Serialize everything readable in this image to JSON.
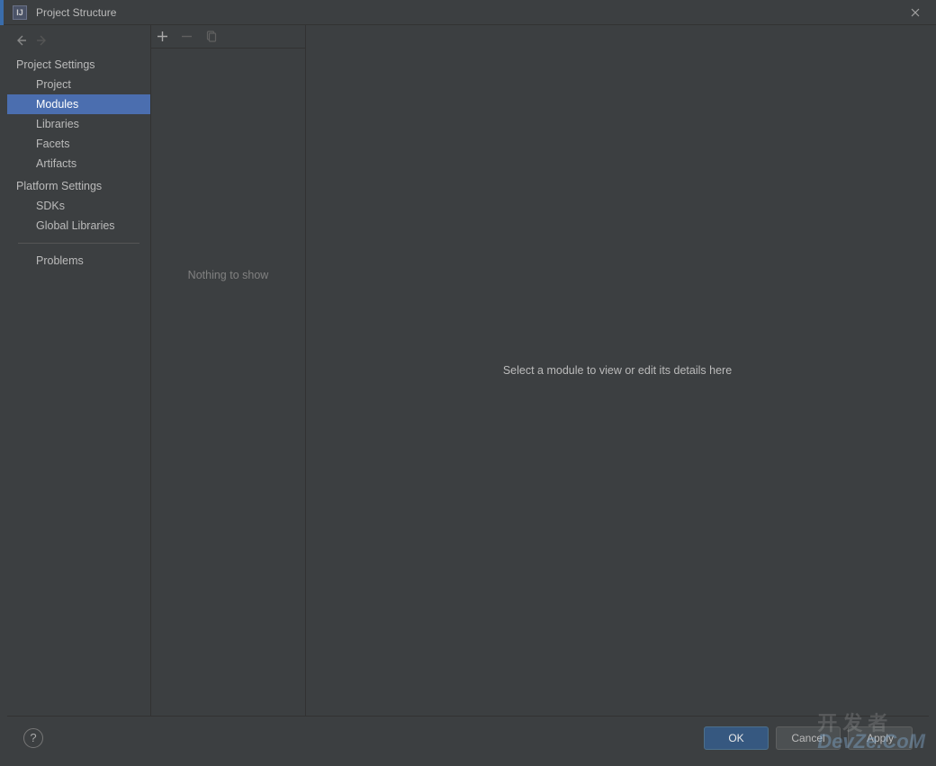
{
  "window": {
    "title": "Project Structure",
    "icon_label": "IJ"
  },
  "sidebar": {
    "sections": [
      {
        "header": "Project Settings",
        "items": [
          {
            "label": "Project",
            "selected": false
          },
          {
            "label": "Modules",
            "selected": true
          },
          {
            "label": "Libraries",
            "selected": false
          },
          {
            "label": "Facets",
            "selected": false
          },
          {
            "label": "Artifacts",
            "selected": false
          }
        ]
      },
      {
        "header": "Platform Settings",
        "items": [
          {
            "label": "SDKs",
            "selected": false
          },
          {
            "label": "Global Libraries",
            "selected": false
          }
        ]
      }
    ],
    "problems": {
      "label": "Problems"
    }
  },
  "module_list": {
    "empty_text": "Nothing to show"
  },
  "detail_panel": {
    "empty_text": "Select a module to view or edit its details here"
  },
  "buttons": {
    "help": "?",
    "ok": "OK",
    "cancel": "Cancel",
    "apply": "Apply"
  },
  "watermark": {
    "cn": "开发者",
    "en": "DevZe.CoM"
  }
}
